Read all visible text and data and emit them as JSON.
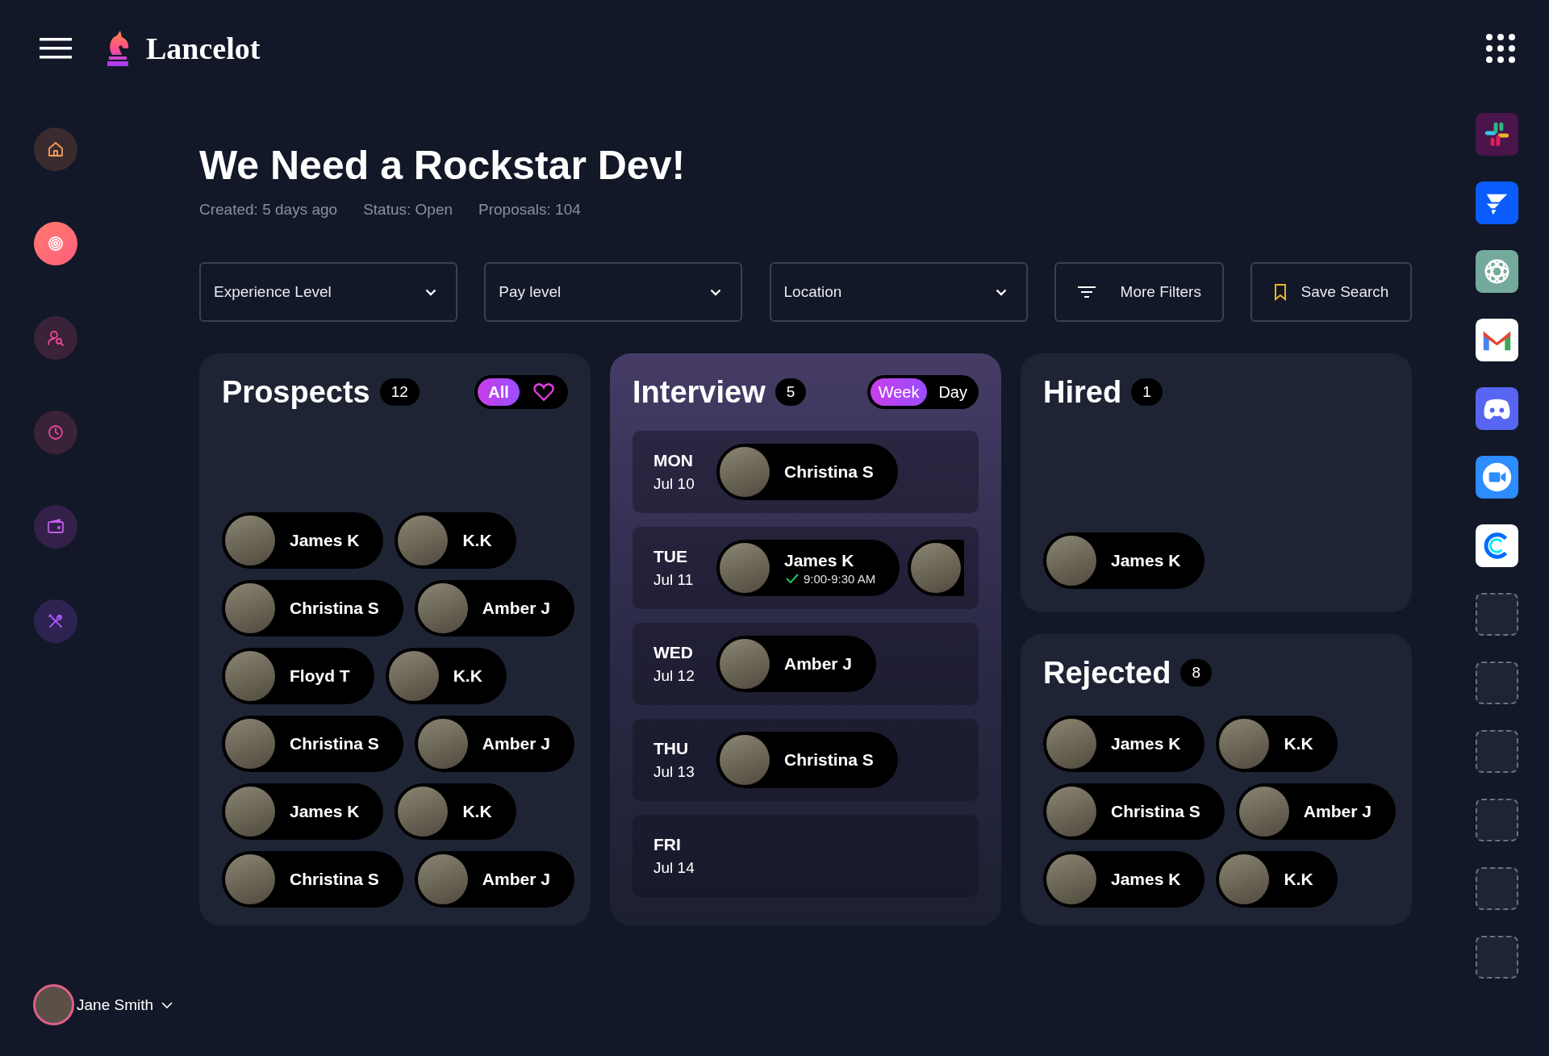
{
  "app": {
    "name": "Lancelot"
  },
  "sidebar": {
    "items": [
      {
        "kind": "home",
        "selected": false
      },
      {
        "kind": "target",
        "selected": true
      },
      {
        "kind": "people",
        "selected": false
      },
      {
        "kind": "clock",
        "selected": false
      },
      {
        "kind": "wallet",
        "selected": false
      },
      {
        "kind": "tools",
        "selected": false
      }
    ],
    "user": {
      "name": "Jane Smith"
    }
  },
  "job": {
    "title": "We Need a Rockstar Dev!",
    "meta": [
      "Created: 5 days ago",
      "Status: Open",
      "Proposals: 104"
    ]
  },
  "filters": [
    {
      "kind": "dropdown",
      "label": "Experience Level"
    },
    {
      "kind": "dropdown",
      "label": "Pay level"
    },
    {
      "kind": "dropdown",
      "label": "Location"
    },
    {
      "kind": "filters",
      "label": "More Filters"
    },
    {
      "kind": "save",
      "label": "Save Search"
    }
  ],
  "prospects": {
    "title": "Prospects",
    "count": "12",
    "toggle": [
      {
        "kind": "text",
        "label": "All",
        "selected": true
      },
      {
        "kind": "heart",
        "selected": false
      }
    ],
    "rows": [
      {
        "chips": [
          {
            "name": "James K"
          },
          {
            "name": "K.K"
          }
        ]
      },
      {
        "chips": [
          {
            "name": "Christina S"
          },
          {
            "name": "Amber J"
          }
        ]
      },
      {
        "chips": [
          {
            "name": "Floyd T"
          },
          {
            "name": "K.K"
          }
        ]
      },
      {
        "chips": [
          {
            "name": "Christina S"
          },
          {
            "name": "Amber J"
          }
        ]
      },
      {
        "chips": [
          {
            "name": "James K"
          },
          {
            "name": "K.K"
          }
        ]
      },
      {
        "chips": [
          {
            "name": "Christina S"
          },
          {
            "name": "Amber J"
          }
        ]
      }
    ]
  },
  "interview": {
    "title": "Interview",
    "count": "5",
    "toggle": [
      {
        "label": "Week",
        "selected": true
      },
      {
        "label": "Day",
        "selected": false
      }
    ],
    "days": [
      {
        "day": "MON",
        "date": "Jul 10",
        "candidates": [
          {
            "kind": "chip",
            "name": "Christina S"
          }
        ]
      },
      {
        "day": "TUE",
        "date": "Jul 11",
        "candidates": [
          {
            "kind": "chip",
            "name": "James K",
            "time": "9:00-9:30 AM",
            "confirmed": true
          },
          {
            "kind": "cut"
          }
        ]
      },
      {
        "day": "WED",
        "date": "Jul 12",
        "candidates": [
          {
            "kind": "chip",
            "name": "Amber J"
          }
        ]
      },
      {
        "day": "THU",
        "date": "Jul 13",
        "candidates": [
          {
            "kind": "chip",
            "name": "Christina S"
          }
        ]
      },
      {
        "day": "FRI",
        "date": "Jul 14"
      }
    ]
  },
  "hired": {
    "title": "Hired",
    "count": "1",
    "rows": [
      {
        "chips": [
          {
            "name": "James K"
          }
        ]
      }
    ]
  },
  "rejected": {
    "title": "Rejected",
    "count": "8",
    "rows": [
      {
        "chips": [
          {
            "name": "James K"
          },
          {
            "name": "K.K"
          }
        ]
      },
      {
        "chips": [
          {
            "name": "Christina S"
          },
          {
            "name": "Amber J"
          }
        ]
      },
      {
        "chips": [
          {
            "name": "James K"
          },
          {
            "name": "K.K"
          }
        ]
      }
    ]
  },
  "apps": [
    {
      "kind": "pinwheel"
    },
    {
      "kind": "chevrons"
    },
    {
      "kind": "knot"
    },
    {
      "kind": "envelope"
    },
    {
      "kind": "gamepad"
    },
    {
      "kind": "camera"
    },
    {
      "kind": "ring"
    },
    {
      "kind": "empty"
    },
    {
      "kind": "empty"
    },
    {
      "kind": "empty"
    },
    {
      "kind": "empty"
    },
    {
      "kind": "empty"
    },
    {
      "kind": "empty"
    }
  ]
}
